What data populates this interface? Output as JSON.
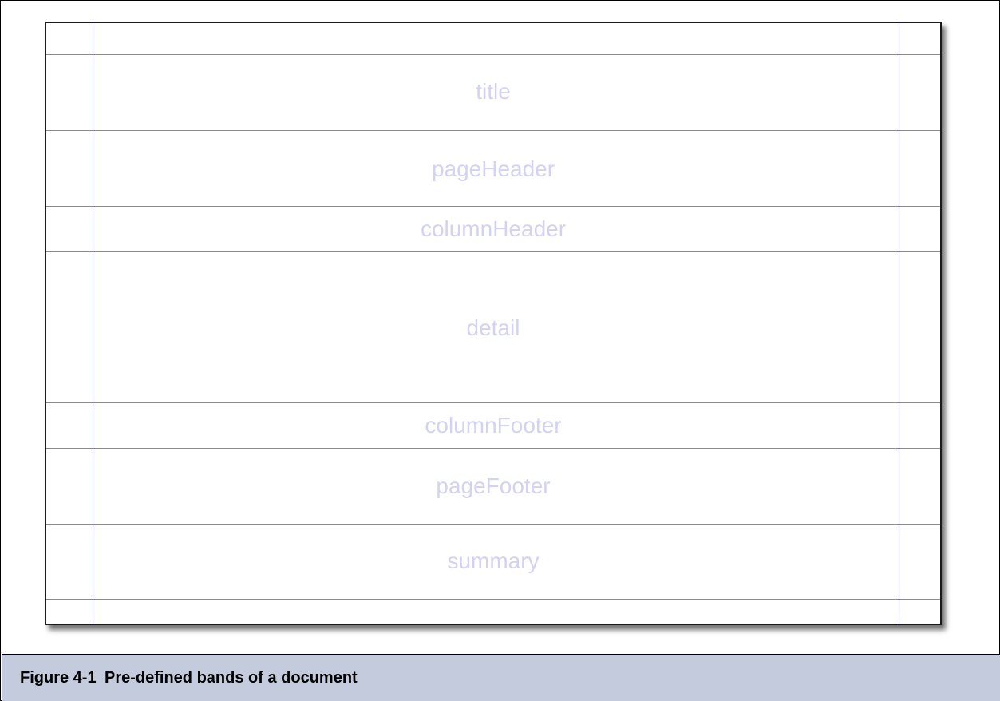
{
  "bands": [
    {
      "label": ""
    },
    {
      "label": "title"
    },
    {
      "label": "pageHeader"
    },
    {
      "label": "columnHeader"
    },
    {
      "label": "detail"
    },
    {
      "label": "columnFooter"
    },
    {
      "label": "pageFooter"
    },
    {
      "label": "summary"
    },
    {
      "label": ""
    }
  ],
  "figure": {
    "number": "Figure 4-1",
    "caption": "Pre-defined bands of a document"
  },
  "colors": {
    "label_color": "#d2d2f2",
    "margin_line": "#9b9bf2",
    "caption_bg": "#c3cbdc"
  }
}
